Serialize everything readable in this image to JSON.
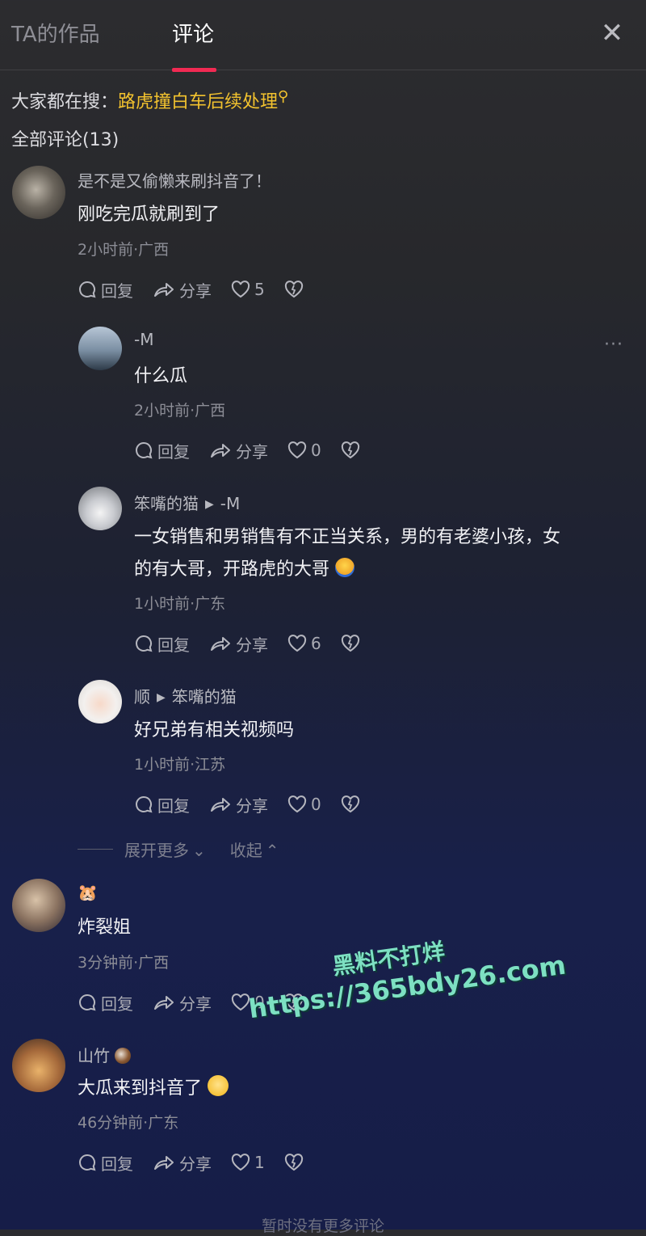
{
  "tabs": {
    "works": "TA的作品",
    "comments": "评论"
  },
  "trending": {
    "prefix": "大家都在搜：",
    "keyword": "路虎撞白车后续处理"
  },
  "comment_count": "全部评论(13)",
  "actions": {
    "reply": "回复",
    "share": "分享"
  },
  "comments": [
    {
      "name": "是不是又偷懒来刷抖音了！",
      "text": "刚吃完瓜就刷到了",
      "meta": "2小时前·广西",
      "likes": "5"
    },
    {
      "name": "-M",
      "text": "什么瓜",
      "meta": "2小时前·广西",
      "likes": "0"
    },
    {
      "name": "笨嘴的猫",
      "reply_to": "-M",
      "text_line1": "一女销售和男销售有不正当关系，男的有老婆小孩，女",
      "text_line2": "的有大哥，开路虎的大哥",
      "meta": "1小时前·广东",
      "likes": "6"
    },
    {
      "name": "顺",
      "reply_to": "笨嘴的猫",
      "text": "好兄弟有相关视频吗",
      "meta": "1小时前·江苏",
      "likes": "0"
    },
    {
      "name": "🐹",
      "text": "炸裂姐",
      "meta": "3分钟前·广西",
      "likes": "0"
    },
    {
      "name": "山竹",
      "text": "大瓜来到抖音了",
      "meta": "46分钟前·广东",
      "likes": "1"
    }
  ],
  "expand": {
    "more": "展开更多",
    "collapse": "收起"
  },
  "watermark": {
    "line1": "黑料不打烊",
    "line2": "https://365bdy26.com"
  },
  "footer": "暂时没有更多评论",
  "icons": {
    "close": "close-icon",
    "search": "search-icon",
    "reply": "comment-bubble-icon",
    "share": "share-arrow-icon",
    "like": "heart-icon",
    "dislike": "broken-heart-icon",
    "more": "more-dots-icon"
  },
  "colors": {
    "accent": "#f12a53",
    "trend": "#f2c22e",
    "watermark": "#7de0c2"
  }
}
